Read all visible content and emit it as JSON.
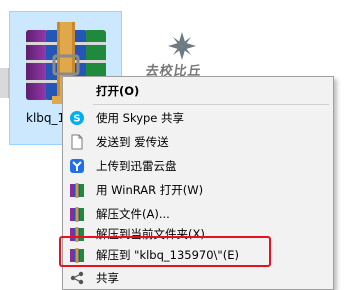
{
  "file": {
    "name": "klbq_135970"
  },
  "thumbnail": {
    "caption": "去校比丘"
  },
  "menu": {
    "items": [
      {
        "label": "打开(O)",
        "icon": "open-icon",
        "bold": true
      },
      {
        "label": "使用 Skype 共享",
        "icon": "skype-icon"
      },
      {
        "label": "发送到 爱传送",
        "icon": "document-icon"
      },
      {
        "label": "上传到迅雷云盘",
        "icon": "xunlei-icon"
      },
      {
        "label": "用 WinRAR 打开(W)",
        "icon": "winrar-icon"
      },
      {
        "label": "解压文件(A)...",
        "icon": "winrar-icon"
      },
      {
        "label": "解压到当前文件夹(X)",
        "icon": "winrar-icon"
      },
      {
        "label": "解压到 \"klbq_135970\\\"(E)",
        "icon": "winrar-icon"
      },
      {
        "label": "共享",
        "icon": "share-icon"
      }
    ]
  },
  "colors": {
    "selection": "#cce8ff",
    "highlight_box": "#e81123",
    "menu_bg": "#f2f2f2"
  }
}
